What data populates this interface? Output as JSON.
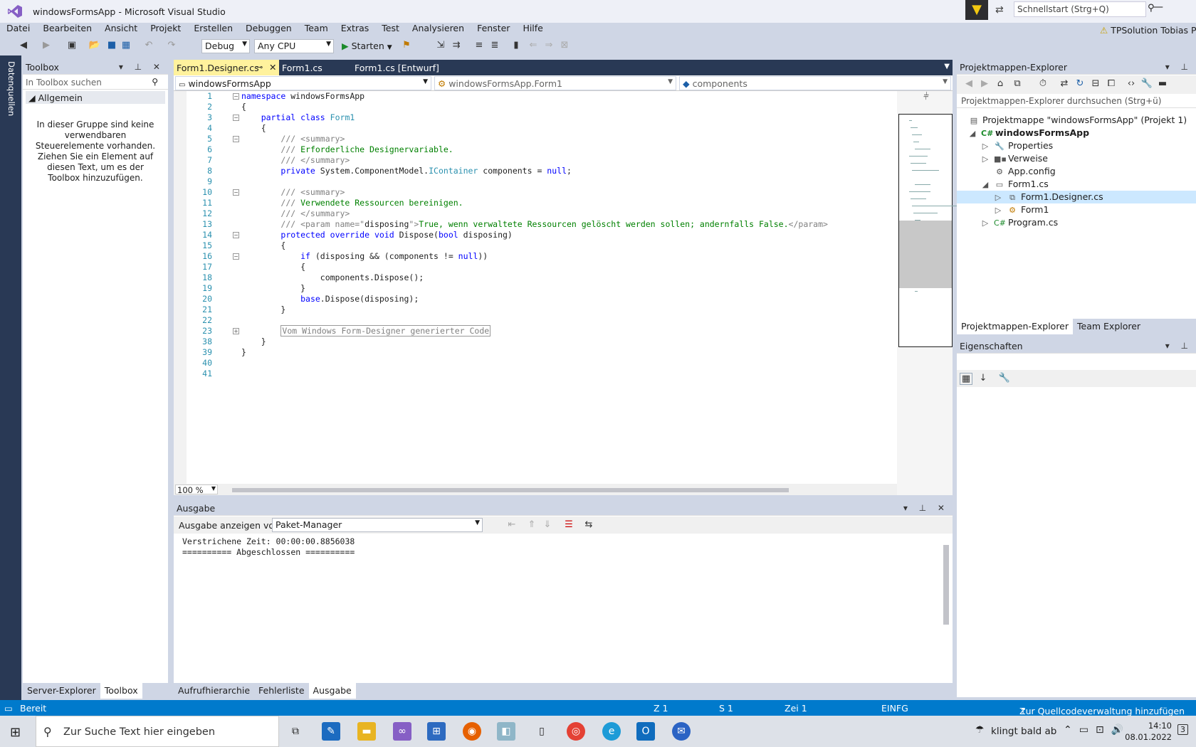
{
  "window": {
    "title": "windowsFormsApp - Microsoft Visual Studio",
    "quicklaunch_placeholder": "Schnellstart (Strg+Q)",
    "user": "TPSolution Tobias Pet"
  },
  "menu": [
    "Datei",
    "Bearbeiten",
    "Ansicht",
    "Projekt",
    "Erstellen",
    "Debuggen",
    "Team",
    "Extras",
    "Test",
    "Analysieren",
    "Fenster",
    "Hilfe"
  ],
  "toolbar": {
    "config": "Debug",
    "platform": "Any CPU",
    "start": "Starten"
  },
  "side": {
    "datenquellen": "Datenquellen"
  },
  "toolbox": {
    "title": "Toolbox",
    "search_placeholder": "In Toolbox suchen",
    "group": "Allgemein",
    "empty_text": "In dieser Gruppe sind keine verwendbaren Steuerelemente vorhanden. Ziehen Sie ein Element auf diesen Text, um es der Toolbox hinzuzufügen.",
    "tabs": [
      "Server-Explorer",
      "Toolbox"
    ]
  },
  "editor": {
    "tabs": [
      "Form1.Designer.cs",
      "Form1.cs",
      "Form1.cs [Entwurf]"
    ],
    "nav": [
      "windowsFormsApp",
      "windowsFormsApp.Form1",
      "components"
    ],
    "zoom": "100 %",
    "line_numbers": [
      "1",
      "2",
      "3",
      "4",
      "5",
      "6",
      "7",
      "8",
      "9",
      "10",
      "11",
      "12",
      "13",
      "14",
      "15",
      "16",
      "17",
      "18",
      "19",
      "20",
      "21",
      "22",
      "23",
      "38",
      "39",
      "40",
      "41"
    ]
  },
  "output": {
    "title": "Ausgabe",
    "show_from_label": "Ausgabe anzeigen von:",
    "source": "Paket-Manager",
    "lines": [
      "Verstrichene Zeit: 00:00:00.8856038",
      "========== Abgeschlossen =========="
    ],
    "bottom_tabs": [
      "Aufrufhierarchie",
      "Fehlerliste",
      "Ausgabe"
    ]
  },
  "solution": {
    "title": "Projektmappen-Explorer",
    "search_placeholder": "Projektmappen-Explorer durchsuchen (Strg+ü)",
    "items": [
      "Projektmappe \"windowsFormsApp\" (Projekt 1)",
      "windowsFormsApp",
      "Properties",
      "Verweise",
      "App.config",
      "Form1.cs",
      "Form1.Designer.cs",
      "Form1",
      "Program.cs"
    ],
    "tabs": [
      "Projektmappen-Explorer",
      "Team Explorer"
    ]
  },
  "properties": {
    "title": "Eigenschaften"
  },
  "status": {
    "ready": "Bereit",
    "z": "Z 1",
    "s": "S 1",
    "zei": "Zei 1",
    "mode": "EINFG",
    "scm": "Zur Quellcodeverwaltung hinzufügen"
  },
  "taskbar": {
    "search": "Zur Suche Text hier eingeben",
    "weather": "klingt bald ab",
    "time": "14:10",
    "date": "08.01.2022",
    "notifications": "3"
  }
}
